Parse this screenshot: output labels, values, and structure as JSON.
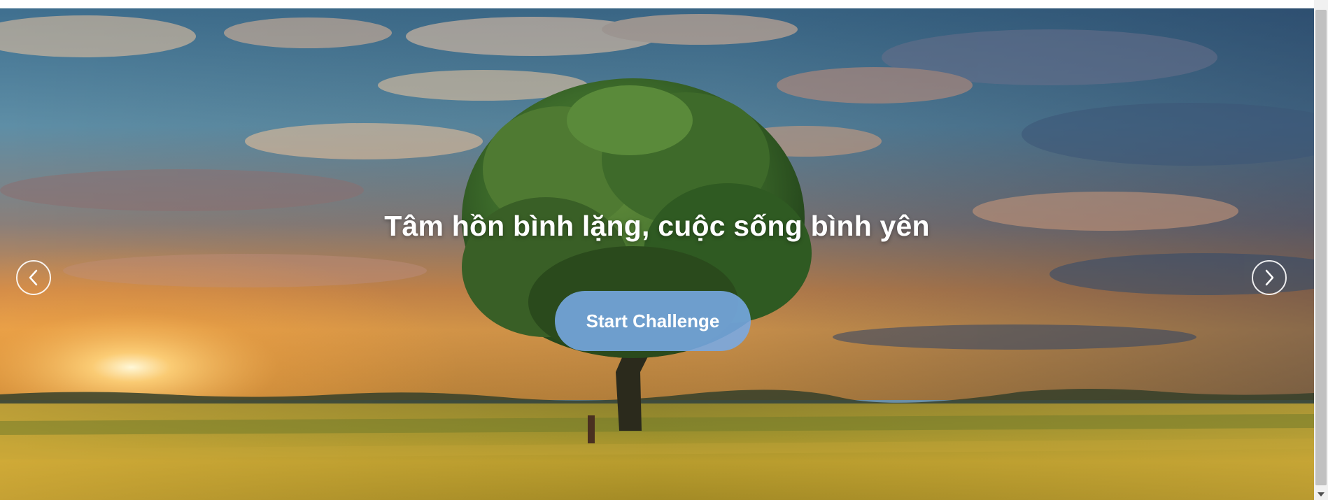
{
  "hero": {
    "headline": "Tâm hồn bình lặng, cuộc sống bình yên",
    "cta_label": "Start Challenge",
    "background_image": "sunset-tree-wheat-field"
  },
  "carousel": {
    "prev_icon": "chevron-left-icon",
    "next_icon": "chevron-right-icon"
  },
  "colors": {
    "cta_background": "#78aae6",
    "headline_text": "#ffffff",
    "arrow_stroke": "#ffffff"
  }
}
